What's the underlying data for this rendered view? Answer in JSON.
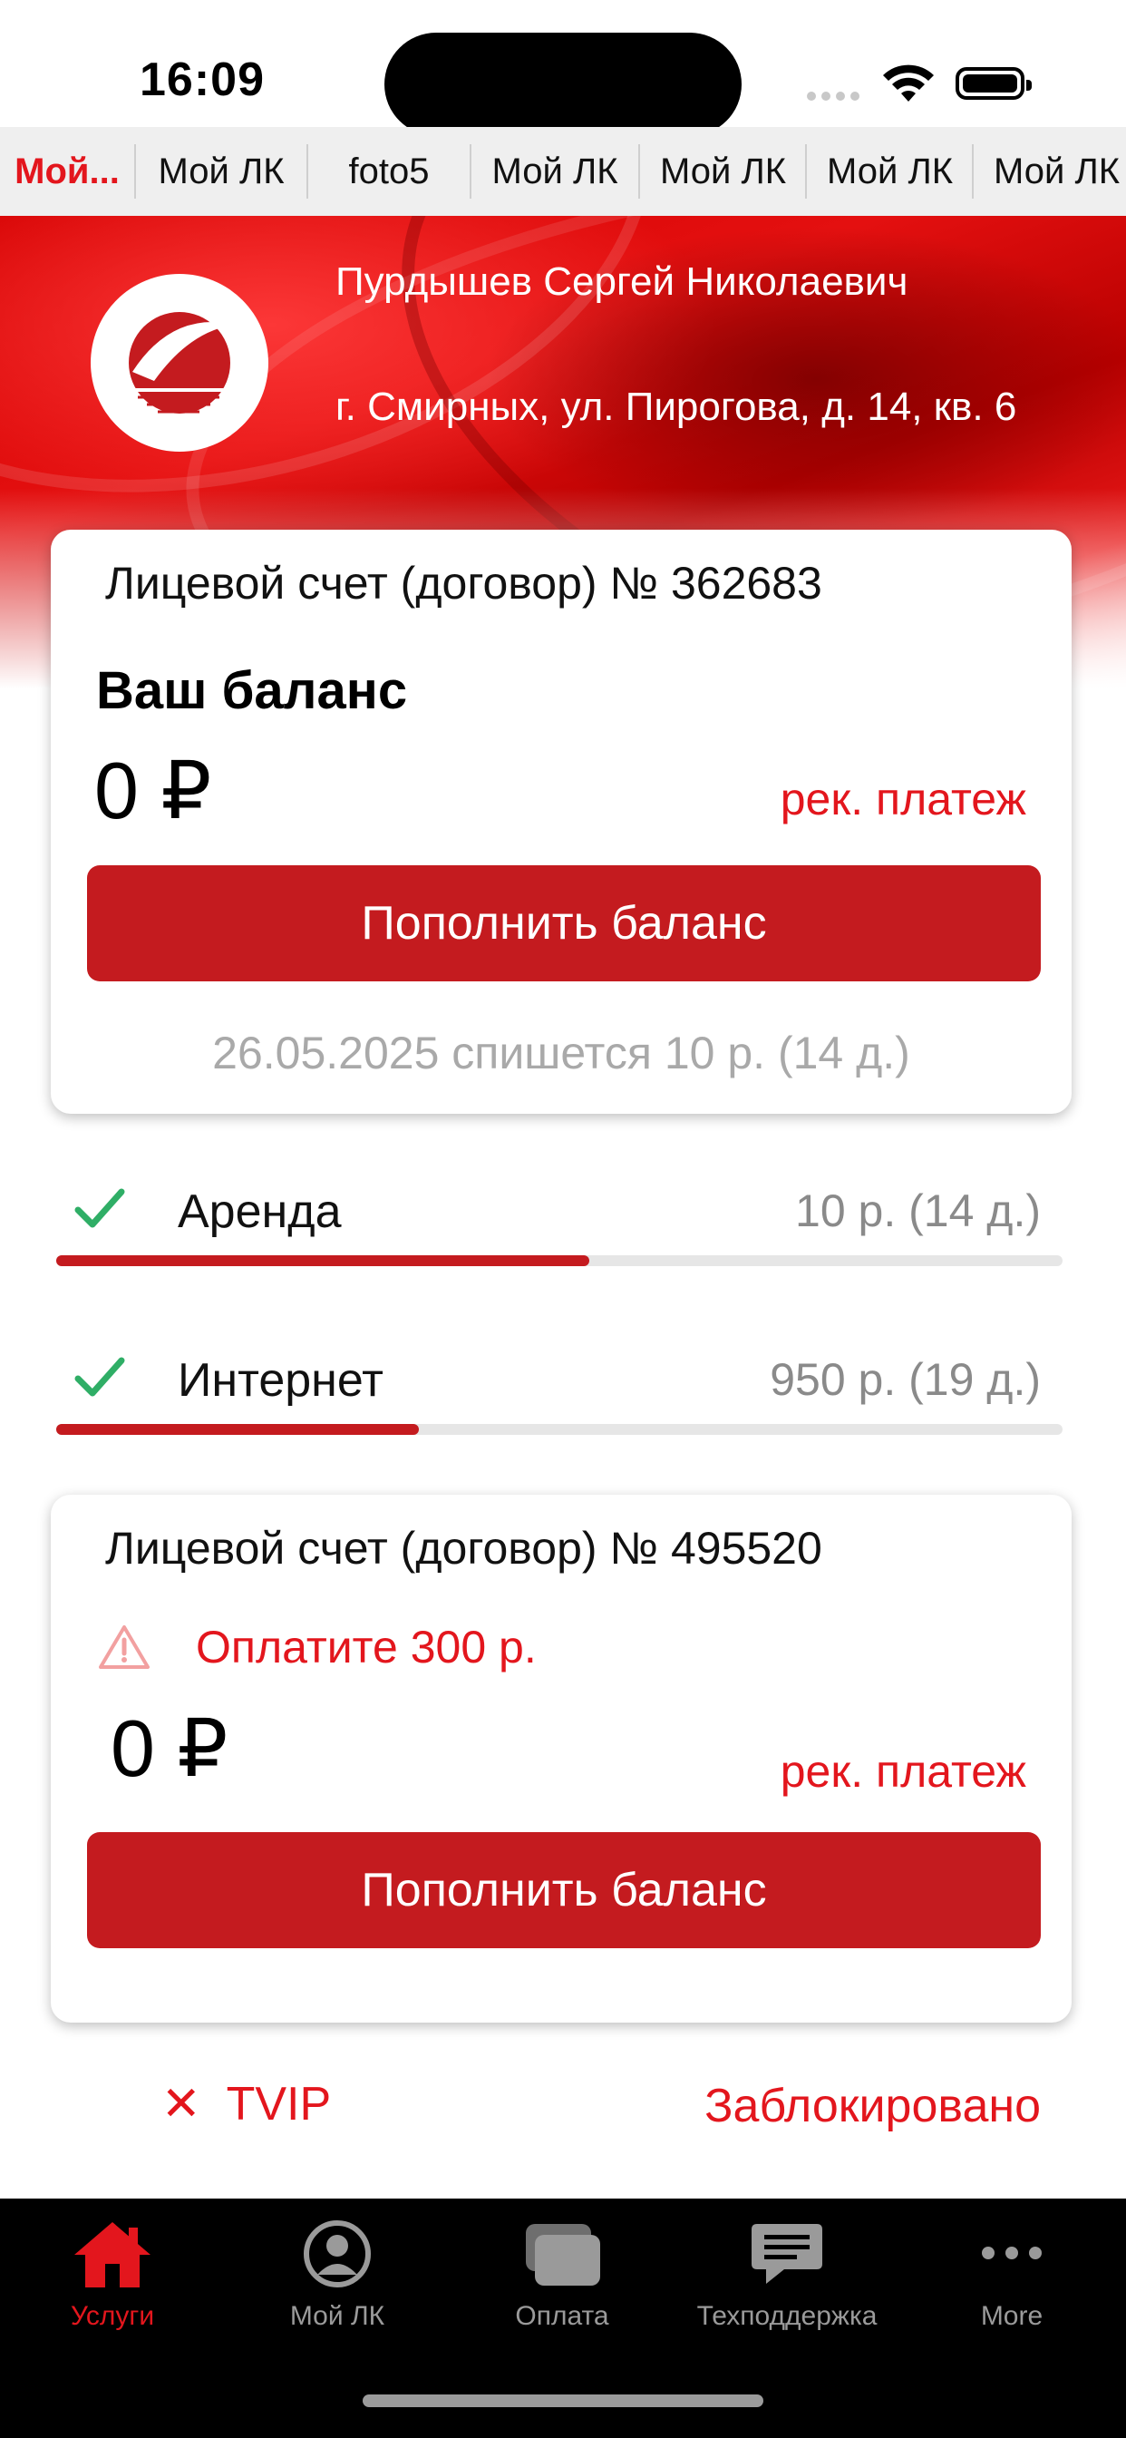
{
  "status_bar": {
    "time": "16:09"
  },
  "tabs": [
    "Мой...",
    "Мой ЛК",
    "foto5",
    "Мой ЛК",
    "Мой ЛК",
    "Мой ЛК",
    "Мой ЛК"
  ],
  "header": {
    "user_name": "Пурдышев Сергей Николаевич",
    "address": "г. Смирных, ул. Пирогова, д. 14, кв. 6"
  },
  "account1": {
    "title": "Лицевой счет (договор) № 362683",
    "balance_title": "Ваш баланс",
    "balance": "0 ₽",
    "recommended_link": "рек. платеж",
    "topup_label": "Пополнить баланс",
    "charge_note": "26.05.2025 спишется  10 р. (14 д.)"
  },
  "services": [
    {
      "name": "Аренда",
      "price": "10 р. (14 д.)",
      "progress": 0.53
    },
    {
      "name": "Интернет",
      "price": "950 р. (19 д.)",
      "progress": 0.36
    }
  ],
  "account2": {
    "title": "Лицевой счет (договор) №  495520",
    "warning": "Оплатите  300 р.",
    "balance": "0 ₽",
    "recommended_link": "рек. платеж",
    "topup_label": "Пополнить баланс"
  },
  "tvip": {
    "name": "TVIP",
    "status": "Заблокировано"
  },
  "tabbar": [
    {
      "label": "Услуги",
      "icon": "house-icon",
      "active": true
    },
    {
      "label": "Мой ЛК",
      "icon": "person-circle-icon",
      "active": false
    },
    {
      "label": "Оплата",
      "icon": "cards-icon",
      "active": false
    },
    {
      "label": "Техподдержка",
      "icon": "chat-bubble-icon",
      "active": false
    },
    {
      "label": "More",
      "icon": "more-dots-icon",
      "active": false
    }
  ],
  "colors": {
    "accent": "#e3161d",
    "button": "#c41b1f",
    "check": "#2fae66"
  }
}
